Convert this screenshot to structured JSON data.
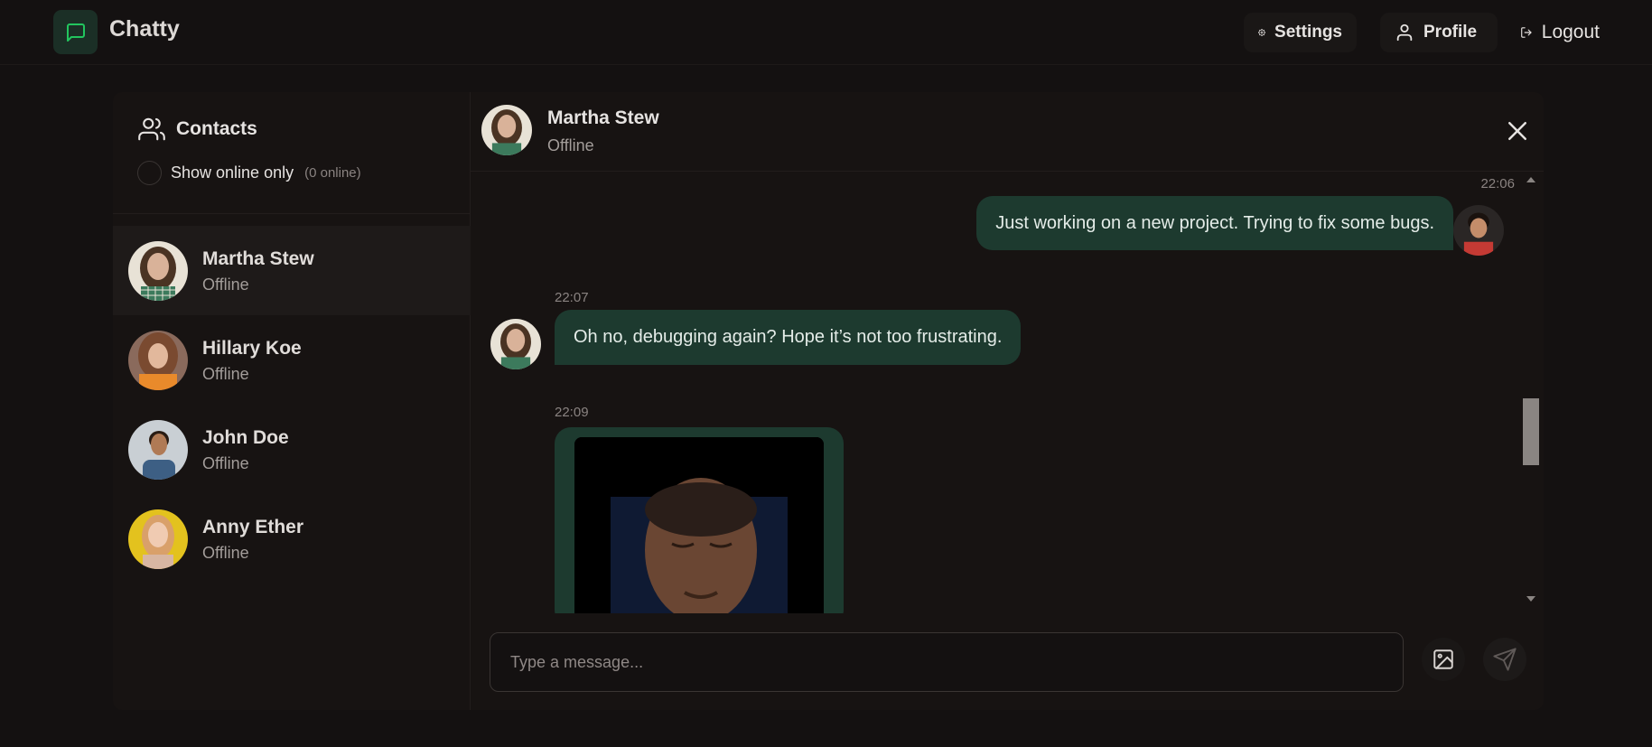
{
  "app": {
    "name": "Chatty"
  },
  "nav": {
    "settings_label": "Settings",
    "profile_label": "Profile",
    "logout_label": "Logout"
  },
  "sidebar": {
    "title": "Contacts",
    "online_toggle_label": "Show online only",
    "online_count": "(0 online)",
    "contacts": [
      {
        "name": "Martha Stew",
        "status": "Offline",
        "active": true
      },
      {
        "name": "Hillary Koe",
        "status": "Offline",
        "active": false
      },
      {
        "name": "John Doe",
        "status": "Offline",
        "active": false
      },
      {
        "name": "Anny Ether",
        "status": "Offline",
        "active": false
      }
    ]
  },
  "chat": {
    "contact_name": "Martha Stew",
    "contact_status": "Offline",
    "messages": [
      {
        "time": "22:06",
        "text": "Just working on a new project. Trying to fix some bugs.",
        "sender": "me"
      },
      {
        "time": "22:07",
        "text": "Oh no, debugging again? Hope it’s not too frustrating.",
        "sender": "contact"
      },
      {
        "time": "22:09",
        "type": "image",
        "sender": "contact"
      }
    ],
    "composer_placeholder": "Type a message..."
  },
  "colors": {
    "accent": "#22c55e",
    "bubble": "#1d3a2f",
    "background": "#141111"
  }
}
